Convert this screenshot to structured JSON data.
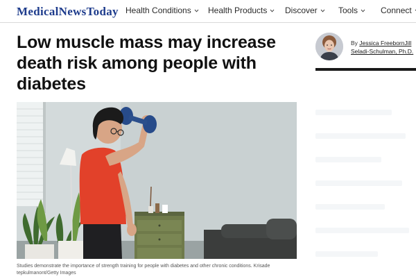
{
  "site": {
    "logo_part1": "Medical",
    "logo_part2": "News",
    "logo_part3": "Today",
    "brand_color": "#1d3b8c"
  },
  "nav": {
    "items": [
      {
        "label": "Health Conditions",
        "icon": "chevron-down-icon"
      },
      {
        "label": "Health Products",
        "icon": "chevron-down-icon"
      },
      {
        "label": "Discover",
        "icon": "chevron-down-icon"
      },
      {
        "label": "Tools",
        "icon": "chevron-down-icon"
      },
      {
        "label": "Connect",
        "icon": "chevron-down-icon"
      }
    ]
  },
  "article": {
    "headline": "Low muscle mass may increase death risk among people with diabetes",
    "byline_prefix": "By ",
    "author1": "Jessica Freeborn",
    "author2": "Jill Seladi-Schulman, Ph.D.",
    "caption": "Studies demonstrate the importance of strength training for people with diabetes and other chronic conditions. Krisade tepkulmanont/Getty Images"
  }
}
